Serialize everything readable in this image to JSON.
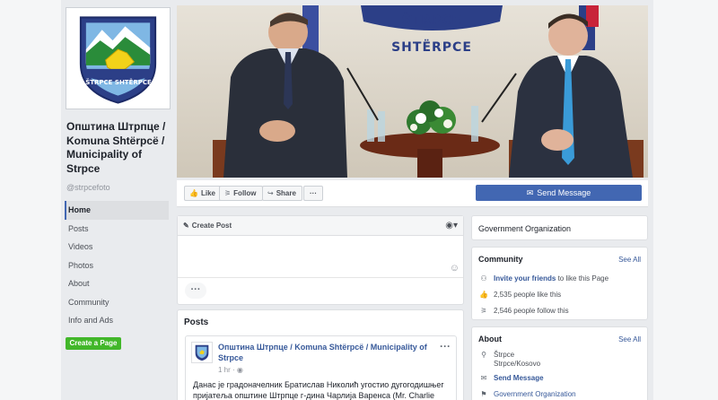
{
  "page": {
    "name": "Општина Штрпце / Komuna Shtërpcë / Municipality of Strpce",
    "handle": "@strpcefoto",
    "logo_text": "ŠTRPCE SHTËRPCE",
    "cover_banner_text": "ŠTRPCE SHTËRPCE"
  },
  "nav": {
    "items": [
      {
        "label": "Home",
        "active": true
      },
      {
        "label": "Posts"
      },
      {
        "label": "Videos"
      },
      {
        "label": "Photos"
      },
      {
        "label": "About"
      },
      {
        "label": "Community"
      },
      {
        "label": "Info and Ads"
      }
    ],
    "create_page": "Create a Page"
  },
  "actions": {
    "like": "Like",
    "follow": "Follow",
    "share": "Share",
    "more": "···",
    "send_message": "Send Message"
  },
  "create_post": {
    "title": "Create Post",
    "more": "···"
  },
  "posts": {
    "title": "Posts",
    "author": "Општина Штрпце / Komuna Shtërpcë / Municipality of Strpce",
    "time": "1 hr ·",
    "text": "Данас је градоначелник Братислав Николић угостио дугогодишњег пријатеља општине Штрпце г-дина Чарлија Варенса (Mr. Charlie"
  },
  "sidebar": {
    "category": "Government Organization",
    "community": {
      "title": "Community",
      "see_all": "See All",
      "invite_link": "Invite your friends",
      "invite_rest": " to like this Page",
      "likes": "2,535 people like this",
      "follows": "2,546 people follow this"
    },
    "about": {
      "title": "About",
      "see_all": "See All",
      "town": "Štrpce",
      "region": "Strpce/Kosovo",
      "send_message": "Send Message",
      "category": "Government Organization"
    }
  },
  "colors": {
    "brand": "#4267b2",
    "link": "#365899",
    "create_page_green": "#42b72a",
    "background": "#e9ebee"
  },
  "icons": [
    "like-icon",
    "follow-icon",
    "share-icon",
    "messenger-icon",
    "pencil-icon",
    "globe-icon",
    "emoji-icon",
    "invite-icon",
    "thumbs-up-icon",
    "follow-rss-icon",
    "location-pin-icon",
    "messenger-icon",
    "category-icon"
  ]
}
